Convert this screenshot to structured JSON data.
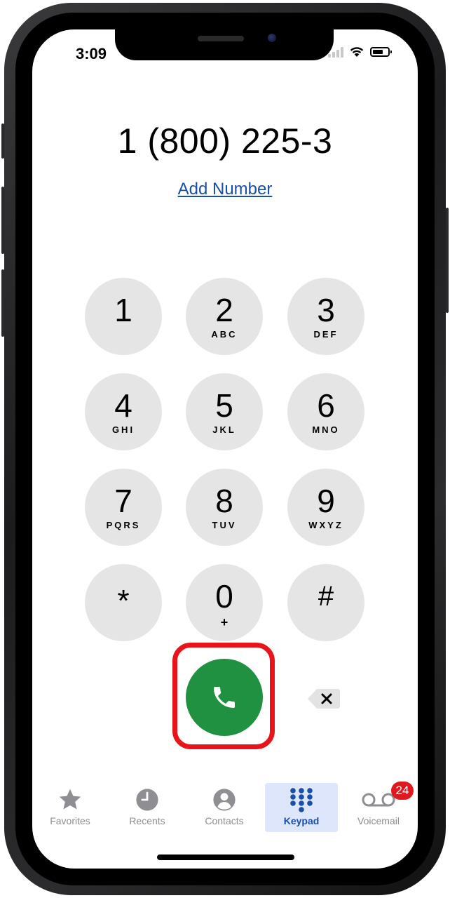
{
  "status_bar": {
    "time": "3:09"
  },
  "dialer": {
    "number": "1 (800) 225-3",
    "add_number": "Add Number"
  },
  "keypad": [
    {
      "digit": "1",
      "letters": ""
    },
    {
      "digit": "2",
      "letters": "ABC"
    },
    {
      "digit": "3",
      "letters": "DEF"
    },
    {
      "digit": "4",
      "letters": "GHI"
    },
    {
      "digit": "5",
      "letters": "JKL"
    },
    {
      "digit": "6",
      "letters": "MNO"
    },
    {
      "digit": "7",
      "letters": "PQRS"
    },
    {
      "digit": "8",
      "letters": "TUV"
    },
    {
      "digit": "9",
      "letters": "WXYZ"
    },
    {
      "digit": "*",
      "letters": ""
    },
    {
      "digit": "0",
      "letters": "+"
    },
    {
      "digit": "#",
      "letters": ""
    }
  ],
  "call_button": {
    "icon": "phone-icon",
    "color": "#1f9140",
    "highlight_color": "#e8141a"
  },
  "delete_button": {
    "icon": "backspace-icon"
  },
  "tab_bar": {
    "tabs": [
      {
        "label": "Favorites",
        "icon": "star-icon"
      },
      {
        "label": "Recents",
        "icon": "clock-icon"
      },
      {
        "label": "Contacts",
        "icon": "person-icon"
      },
      {
        "label": "Keypad",
        "icon": "keypad-icon"
      },
      {
        "label": "Voicemail",
        "icon": "voicemail-icon"
      }
    ],
    "active": "Keypad",
    "voicemail_badge": "24"
  },
  "colors": {
    "accent": "#1a4fa8",
    "key_background": "#e5e5e5",
    "badge": "#e0191f"
  }
}
